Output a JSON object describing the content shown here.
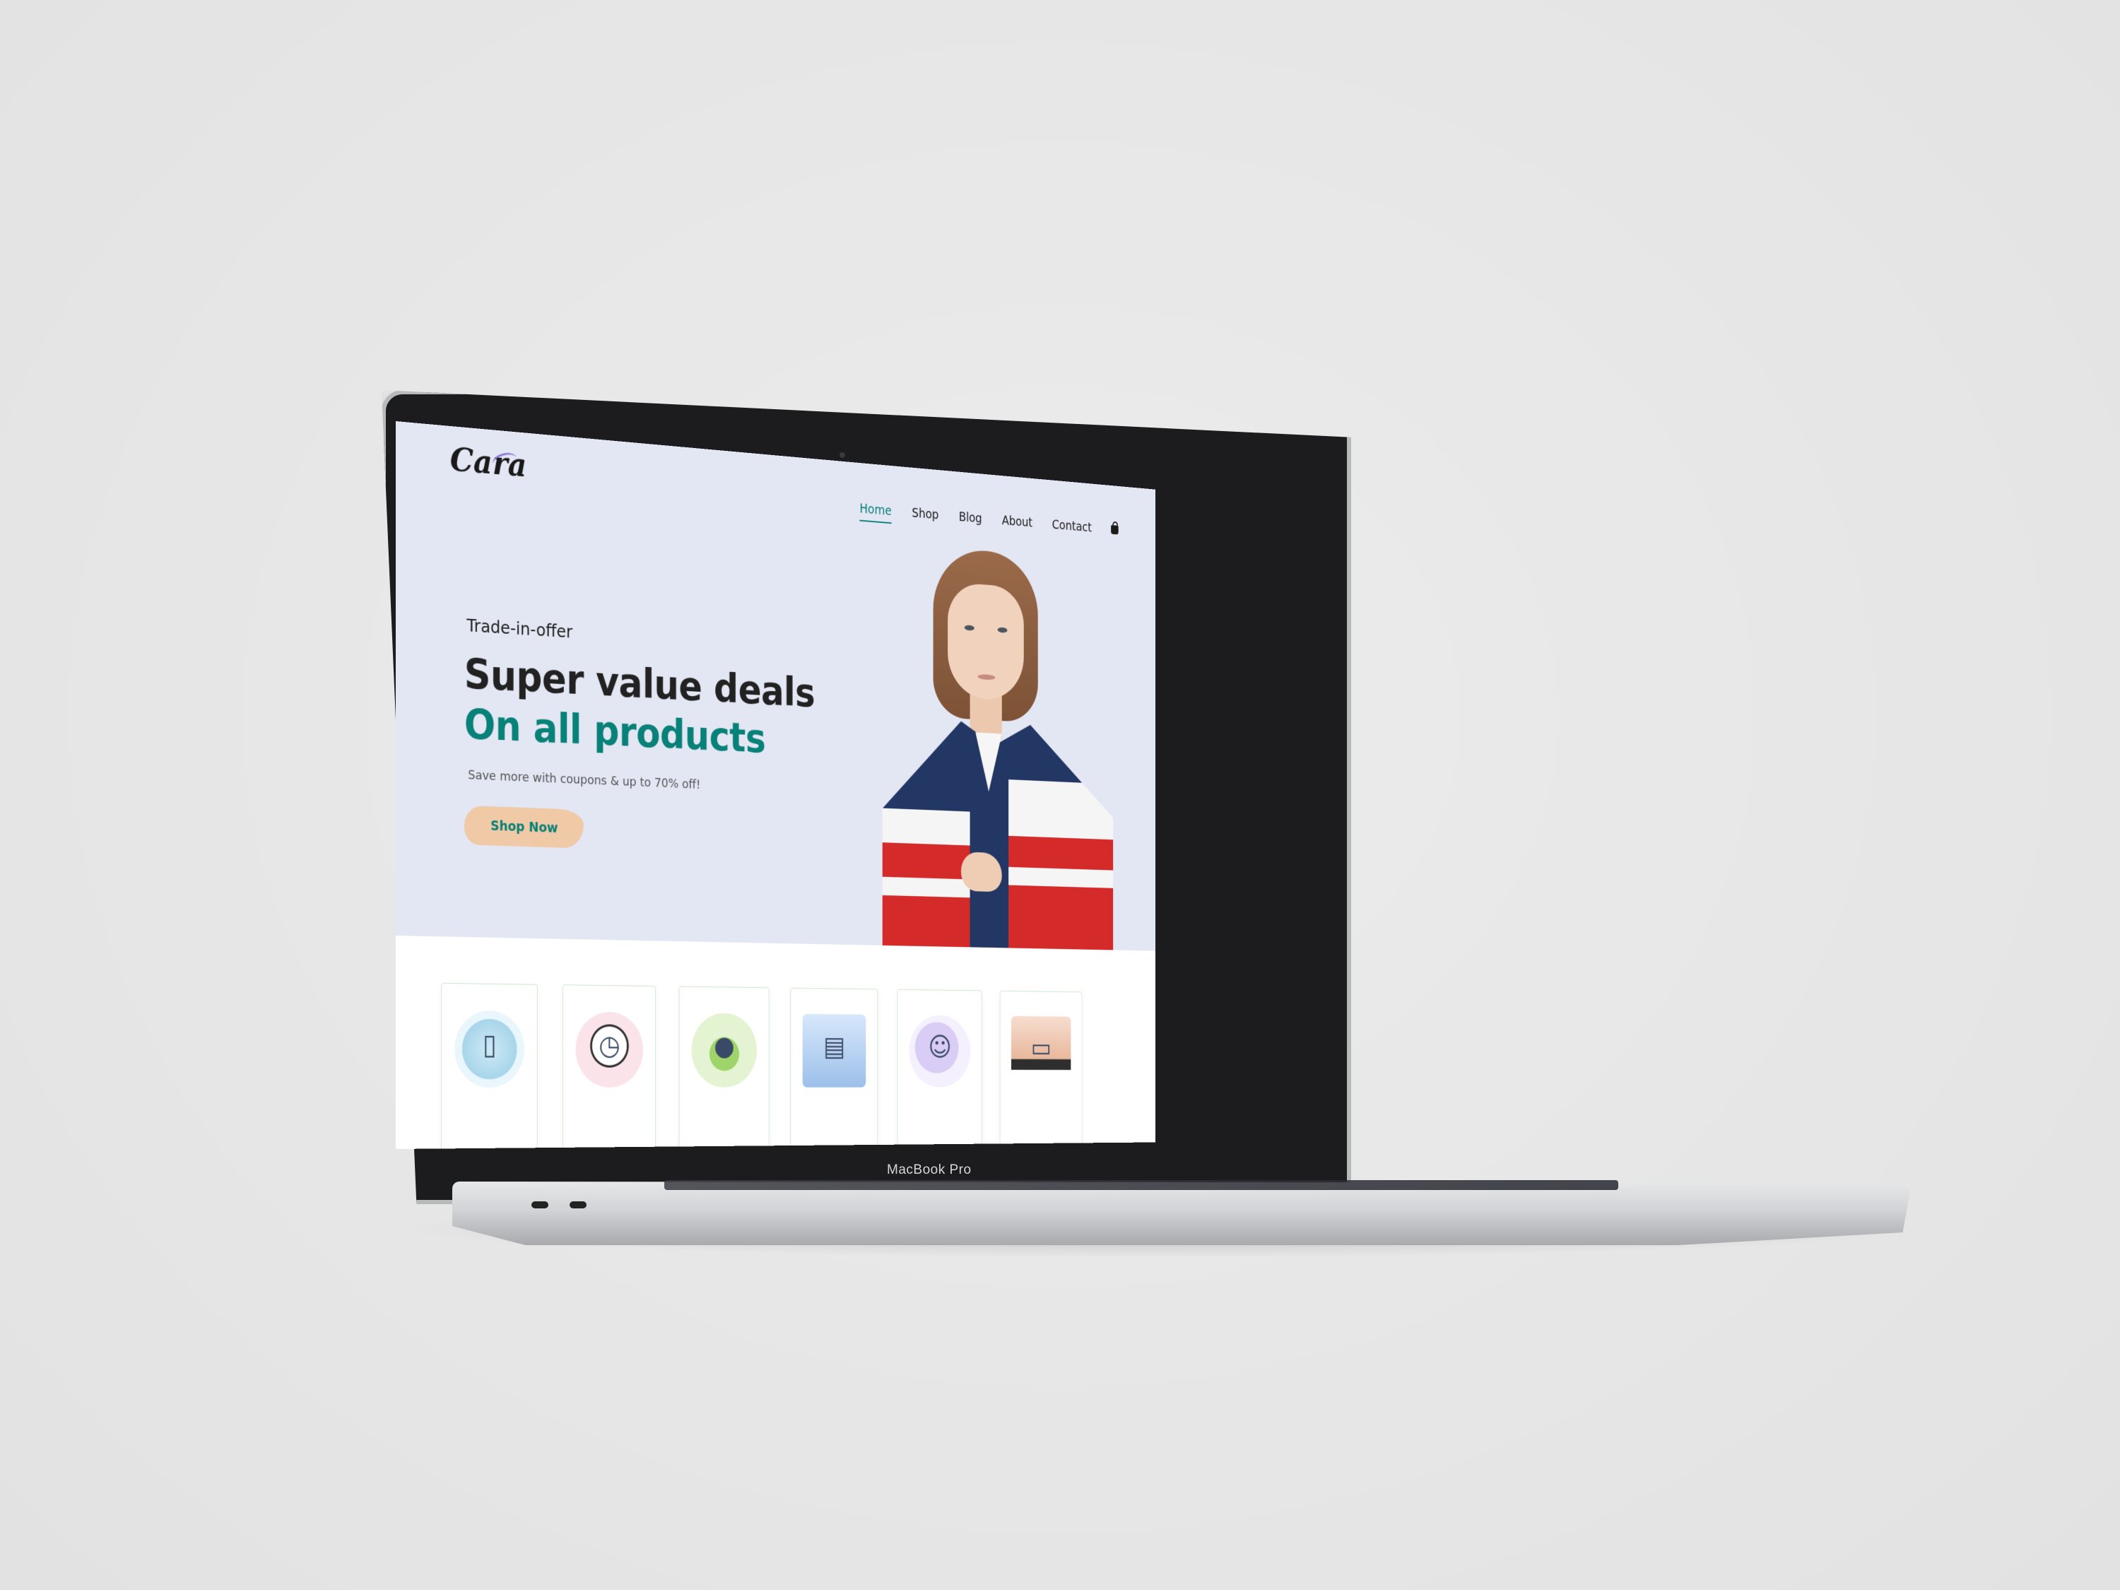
{
  "device": {
    "brand_label": "MacBook Pro"
  },
  "site": {
    "logo": "Cara",
    "nav": [
      "Home",
      "Shop",
      "Blog",
      "About",
      "Contact"
    ],
    "active_nav": "Home",
    "cart_icon": "shopping-bag-icon"
  },
  "hero": {
    "kicker": "Trade-in-offer",
    "title_line_1": "Super value deals",
    "title_line_2": "On all products",
    "subtitle": "Save more with coupons & up to 70% off!",
    "cta_label": "Shop Now"
  },
  "features": {
    "cards": [
      {
        "icon": "phone-illustration-icon"
      },
      {
        "icon": "clock-illustration-icon"
      },
      {
        "icon": "piggy-bank-illustration-icon"
      },
      {
        "icon": "browser-windows-illustration-icon"
      },
      {
        "icon": "people-illustration-icon"
      },
      {
        "icon": "laptop-illustration-icon"
      }
    ]
  },
  "colors": {
    "accent": "#088178",
    "hero_bg": "#e3e6f3",
    "button_bg": "#f0c9a6",
    "page_bg": "#e8e8e8"
  }
}
